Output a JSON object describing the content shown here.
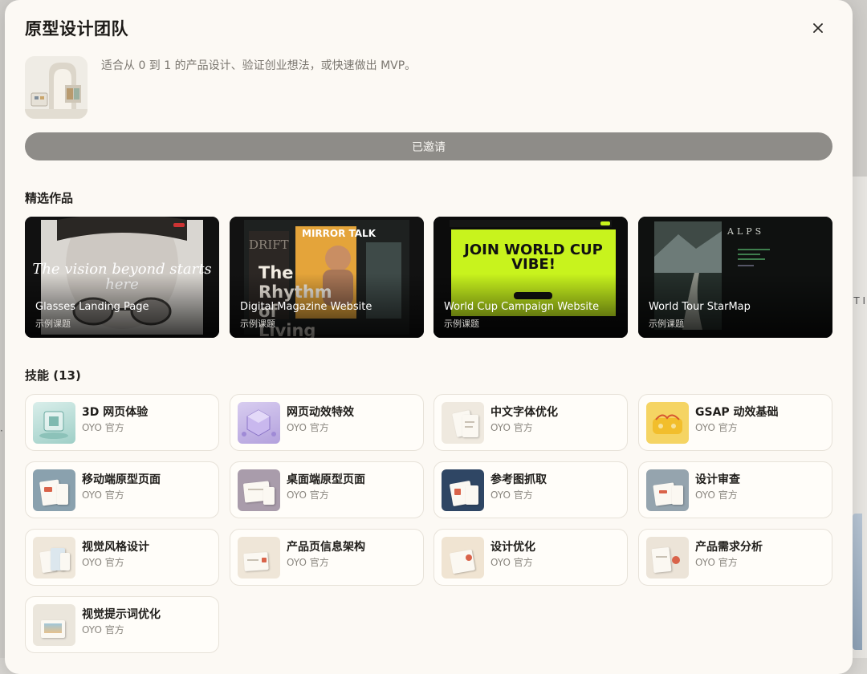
{
  "modal": {
    "title": "原型设计团队",
    "description": "适合从 0 到 1 的产品设计、验证创业想法，或快速做出 MVP。",
    "invited_label": "已邀请"
  },
  "background": {
    "right_text": "T I",
    "left_text": "·"
  },
  "featured": {
    "title": "精选作品",
    "items": [
      {
        "name": "Glasses Landing Page",
        "sub": "示例课题",
        "art_text": "The vision beyond starts here"
      },
      {
        "name": "Digital Magazine Website",
        "sub": "示例课题",
        "art_text": "The Rhythm of Living",
        "art_kicker": "MIRROR TALK",
        "art_small": "DRIFT"
      },
      {
        "name": "World Cup Campaign Website",
        "sub": "示例课题",
        "art_text": "JOIN WORLD CUP VIBE!"
      },
      {
        "name": "World Tour StarMap",
        "sub": "示例课题",
        "art_text": "ALPS"
      }
    ]
  },
  "skills": {
    "title": "技能 (13)",
    "items": [
      {
        "name": "3D 网页体验",
        "author": "OYO 官方",
        "icon": "glass-cube-icon"
      },
      {
        "name": "网页动效特效",
        "author": "OYO 官方",
        "icon": "motion-cube-icon"
      },
      {
        "name": "中文字体优化",
        "author": "OYO 官方",
        "icon": "typography-doc-icon"
      },
      {
        "name": "GSAP 动效基础",
        "author": "OYO 官方",
        "icon": "gsap-block-icon"
      },
      {
        "name": "移动端原型页面",
        "author": "OYO 官方",
        "icon": "mobile-prototype-icon"
      },
      {
        "name": "桌面端原型页面",
        "author": "OYO 官方",
        "icon": "desktop-prototype-icon"
      },
      {
        "name": "参考图抓取",
        "author": "OYO 官方",
        "icon": "reference-capture-icon"
      },
      {
        "name": "设计审查",
        "author": "OYO 官方",
        "icon": "design-audit-icon"
      },
      {
        "name": "视觉风格设计",
        "author": "OYO 官方",
        "icon": "visual-style-icon"
      },
      {
        "name": "产品页信息架构",
        "author": "OYO 官方",
        "icon": "info-architecture-icon"
      },
      {
        "name": "设计优化",
        "author": "OYO 官方",
        "icon": "design-refine-icon"
      },
      {
        "name": "产品需求分析",
        "author": "OYO 官方",
        "icon": "requirements-icon"
      },
      {
        "name": "视觉提示词优化",
        "author": "OYO 官方",
        "icon": "prompt-optimize-icon"
      }
    ]
  },
  "colors": {
    "modal_bg": "#fcf9f4",
    "invited_button": "#8e8c88",
    "world_cup_green": "#c8f31d"
  }
}
